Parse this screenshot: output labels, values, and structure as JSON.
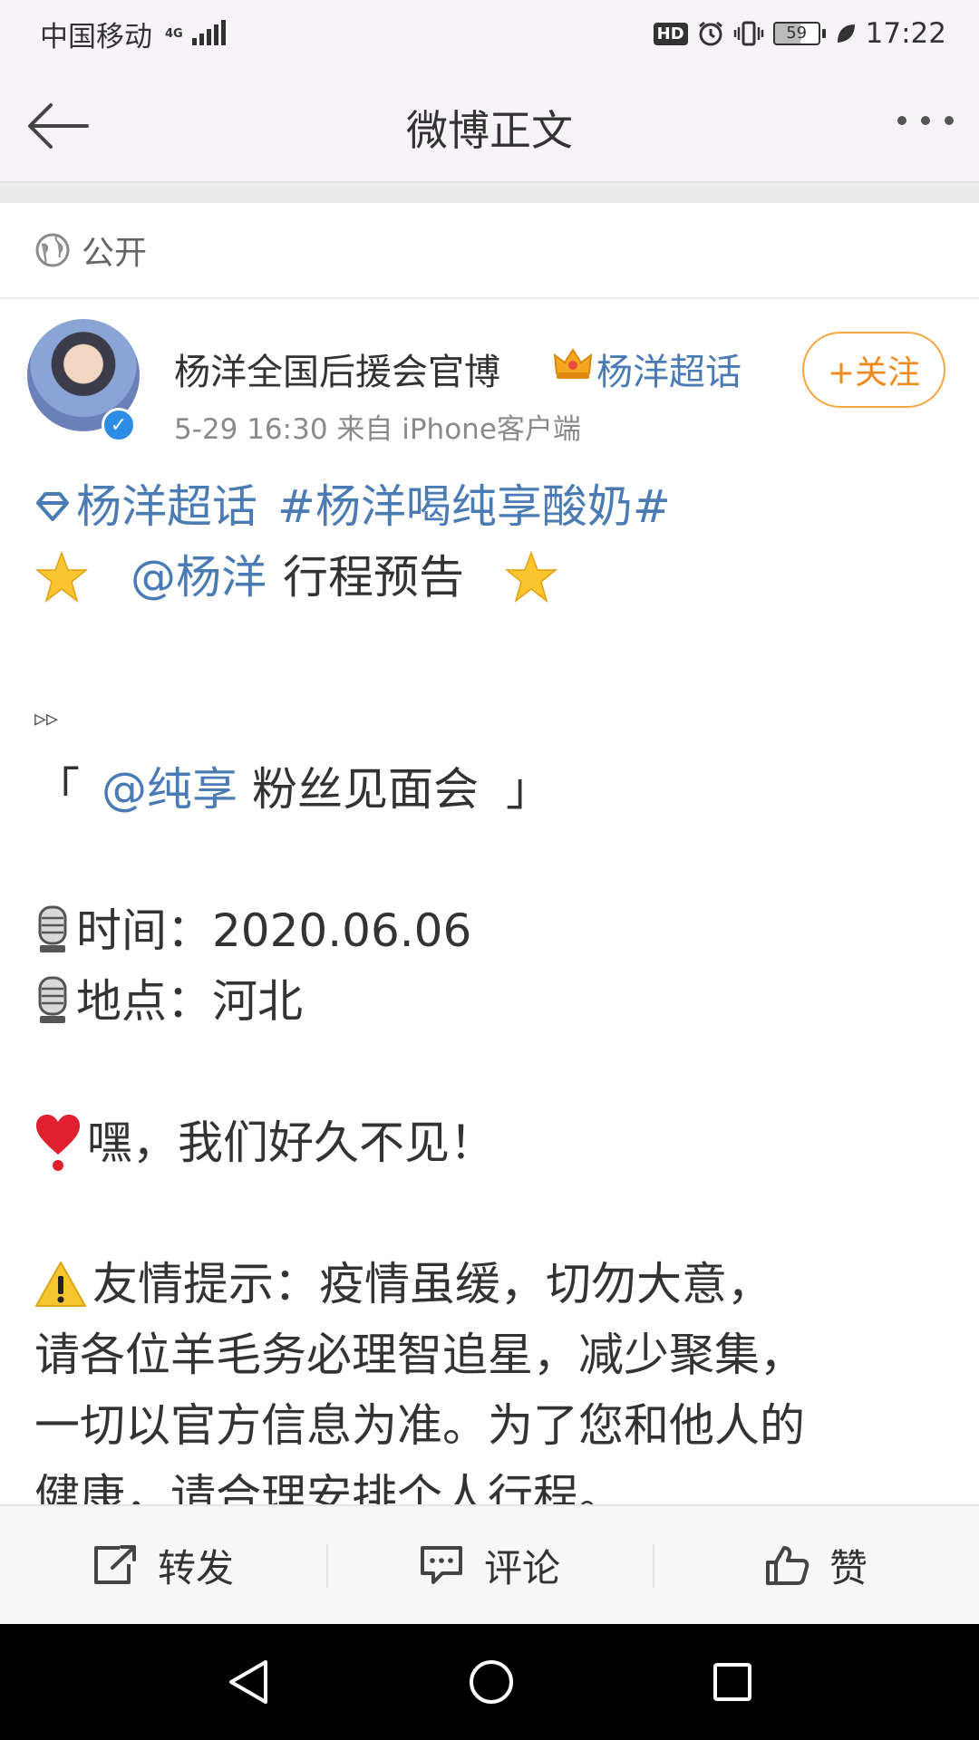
{
  "status_bar": {
    "carrier": "中国移动",
    "network": "4G",
    "battery_level": "59",
    "time": "17:22"
  },
  "nav": {
    "title": "微博正文"
  },
  "visibility": {
    "label": "公开"
  },
  "author": {
    "name": "杨洋全国后援会官博",
    "supertopic": "杨洋超话",
    "meta": "5-29 16:30   来自 iPhone客户端",
    "follow_label": "+关注"
  },
  "post": {
    "supertopic_tag": "杨洋超话",
    "hashtag": "#杨洋喝纯享酸奶#",
    "mention_yang": "@杨洋",
    "schedule_title": "行程预告",
    "arrows": "▹▹",
    "bracket_open": "「",
    "mention_brand": "@纯享",
    "event": "粉丝见面会",
    "bracket_close": "」",
    "time_label": "时间：",
    "time_value": "2020.06.06",
    "place_label": "地点：",
    "place_value": "河北",
    "greeting": "嘿，我们好久不见！",
    "tip_line1": "友情提示：疫情虽缓，切勿大意，",
    "tip_line2": "请各位羊毛务必理智追星，减少聚集，",
    "tip_line3": "一切以官方信息为准。为了您和他人的",
    "tip_line4": "健康，请合理安排个人行程。"
  },
  "actions": {
    "repost": "转发",
    "comment": "评论",
    "like": "赞"
  },
  "colors": {
    "link": "#4a7bb5",
    "follow": "#f08a1c",
    "bar_bg": "#f7f3f9"
  }
}
